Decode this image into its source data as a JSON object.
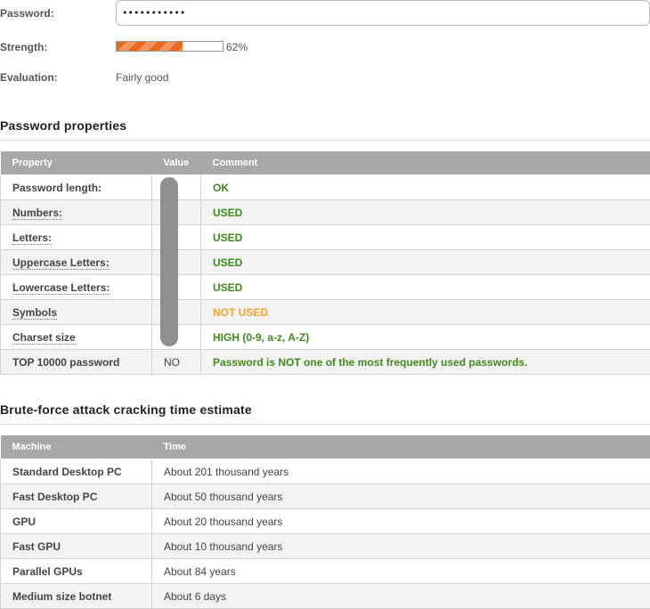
{
  "form": {
    "password_label": "Password:",
    "password_value": "•••••••••••",
    "strength_label": "Strength:",
    "strength_percent": "62%",
    "strength_fraction": 0.62,
    "evaluation_label": "Evaluation:",
    "evaluation_value": "Fairly good"
  },
  "properties": {
    "title": "Password properties",
    "headers": [
      "Property",
      "Value",
      "Comment"
    ],
    "rows": [
      {
        "property": "Password length:",
        "value": "",
        "comment": "OK",
        "status": "ok",
        "dotted": false
      },
      {
        "property": "Numbers:",
        "value": "",
        "comment": "USED",
        "status": "ok",
        "dotted": true
      },
      {
        "property": "Letters:",
        "value": "",
        "comment": "USED",
        "status": "ok",
        "dotted": true
      },
      {
        "property": "Uppercase Letters:",
        "value": "",
        "comment": "USED",
        "status": "ok",
        "dotted": true
      },
      {
        "property": "Lowercase Letters:",
        "value": "",
        "comment": "USED",
        "status": "ok",
        "dotted": true
      },
      {
        "property": "Symbols",
        "value": "",
        "comment": "NOT USED",
        "status": "warn",
        "dotted": true
      },
      {
        "property": "Charset size",
        "value": "",
        "comment": "HIGH (0-9, a-z, A-Z)",
        "status": "ok",
        "dotted": true
      },
      {
        "property": "TOP 10000 password",
        "value": "NO",
        "comment": "Password is NOT one of the most frequently used passwords.",
        "status": "ok",
        "dotted": false
      }
    ]
  },
  "bruteforce": {
    "title": "Brute-force attack cracking time estimate",
    "headers": [
      "Machine",
      "Time"
    ],
    "rows": [
      {
        "machine": "Standard Desktop PC",
        "time": "About 201 thousand years"
      },
      {
        "machine": "Fast Desktop PC",
        "time": "About 50 thousand years"
      },
      {
        "machine": "GPU",
        "time": "About 20 thousand years"
      },
      {
        "machine": "Fast GPU",
        "time": "About 10 thousand years"
      },
      {
        "machine": "Parallel GPUs",
        "time": "About 84 years"
      },
      {
        "machine": "Medium size botnet",
        "time": "About 6 days"
      }
    ]
  },
  "colors": {
    "ok": "#3f8a1c",
    "warn": "#f3a12e",
    "strength_bar": "#e86a21",
    "header_bg": "#a8a8a8"
  }
}
